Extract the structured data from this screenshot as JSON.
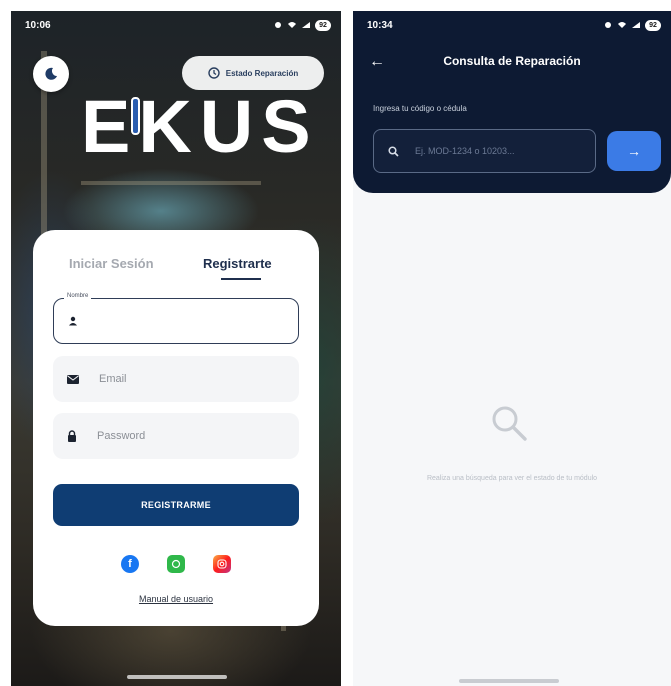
{
  "left_screen": {
    "status_bar": {
      "time": "10:06",
      "battery": "92"
    },
    "theme_toggle_icon": "moon-icon",
    "estado_button_label": "Estado Reparación",
    "logo_text": "EKUS",
    "tabs": {
      "login": "Iniciar Sesión",
      "register": "Registrarte",
      "active": "register"
    },
    "form": {
      "name_label": "Nombre",
      "name_value": "",
      "email_placeholder": "Email",
      "password_placeholder": "Password",
      "submit_label": "REGISTRARME"
    },
    "socials": [
      "facebook-icon",
      "whatsapp-icon",
      "instagram-icon"
    ],
    "manual_link": "Manual de usuario"
  },
  "right_screen": {
    "status_bar": {
      "time": "10:34",
      "battery": "92"
    },
    "title": "Consulta de Reparación",
    "prompt_label": "Ingresa tu código o cédula",
    "search_placeholder": "Ej. MOD-1234 o 10203...",
    "empty_message": "Realiza una búsqueda para ver el estado de tu módulo",
    "colors": {
      "header": "#0d1a33",
      "accent": "#3b7be6",
      "primary_button": "#0f3d73"
    }
  }
}
